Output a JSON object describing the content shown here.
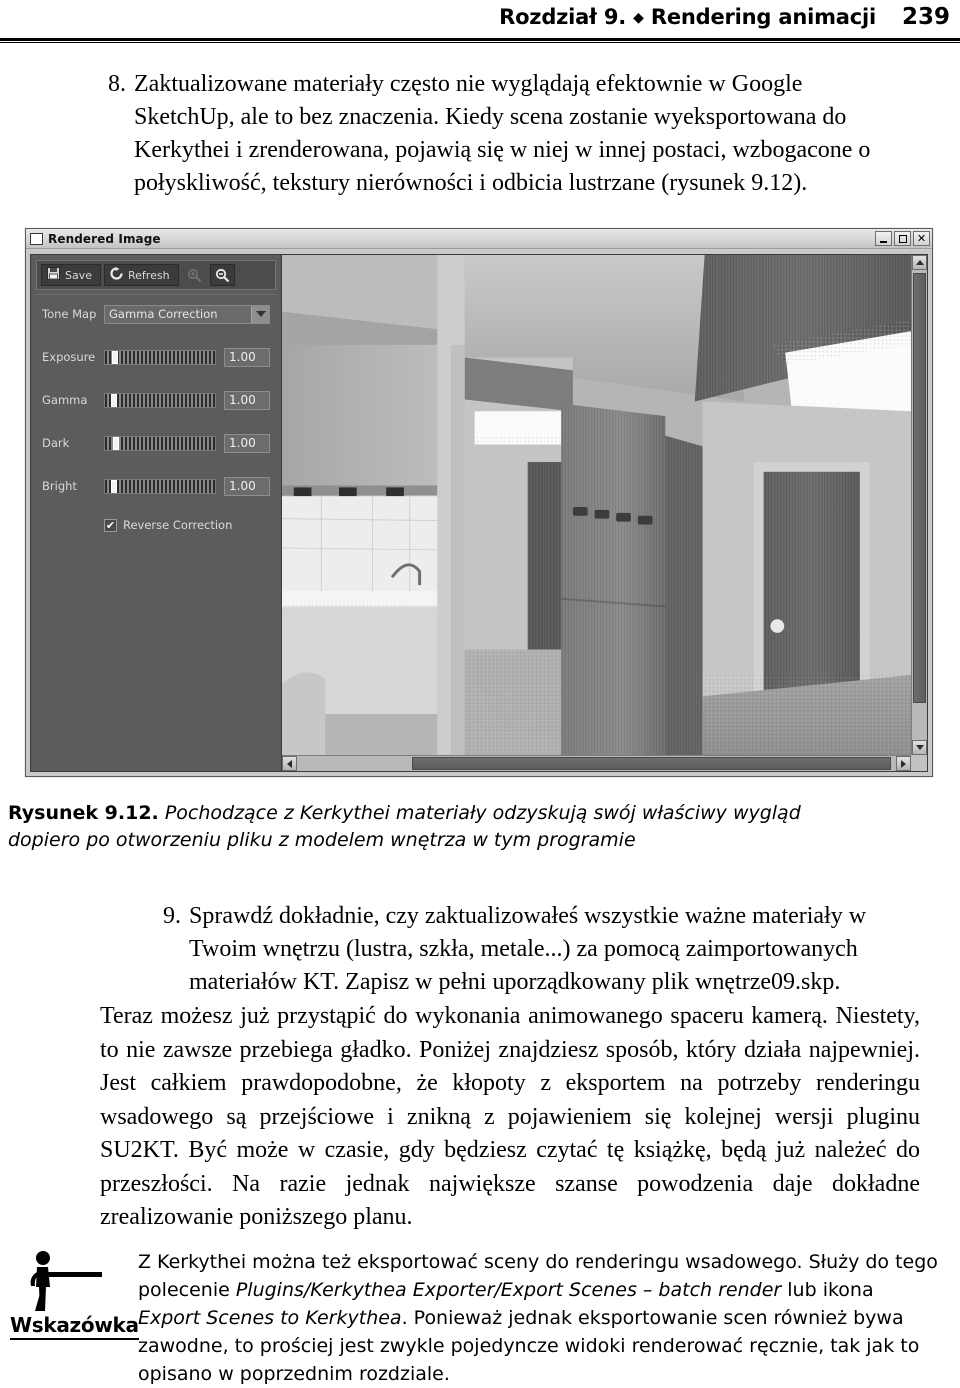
{
  "header": {
    "chapter": "Rozdział 9.",
    "diamond": "◆",
    "title": "Rendering animacji",
    "page_number": "239"
  },
  "steps": [
    {
      "number": "8.",
      "text": "Zaktualizowane materiały często nie wyglądają efektownie w Google SketchUp, ale to bez znaczenia. Kiedy scena zostanie wyeksportowana do Kerkythei i zrenderowana, pojawią się w niej w innej postaci, wzbogacone o połyskliwość, tekstury nierówności i odbicia lustrzane (rysunek 9.12)."
    },
    {
      "number": "9.",
      "text": "Sprawdź dokładnie, czy zaktualizowałeś wszystkie ważne materiały w Twoim wnętrzu (lustra, szkła, metale...) za pomocą zaimportowanych materiałów KT. Zapisz w pełni uporządkowany plik wnętrze09.skp."
    }
  ],
  "figure_caption": {
    "label": "Rysunek 9.12.",
    "text": "Pochodzące z Kerkythei materiały odzyskują swój właściwy wygląd dopiero po otworzeniu pliku z modelem wnętrza w tym programie"
  },
  "paragraph": "Teraz możesz już przystąpić do wykonania animowanego spaceru kamerą. Niestety, to nie zawsze przebiega gładko. Poniżej znajdziesz sposób, który działa najpewniej. Jest całkiem prawdopodobne, że kłopoty z eksportem na potrzeby renderingu wsadowego są przejściowe i znikną z pojawieniem się kolejnej wersji pluginu SU2KT. Być może w czasie, gdy będziesz czytać tę książkę, będą już należeć do przeszłości. Na razie jednak największe szanse powodzenia daje dokładne zrealizowanie poniższego planu.",
  "tip": {
    "label": "Wskazówka",
    "text_parts": [
      {
        "style": "normal",
        "text": "Z Kerkythei można też eksportować sceny do renderingu wsadowego. Służy do tego polecenie "
      },
      {
        "style": "italic",
        "text": "Plugins/Kerkythea Exporter/Export Scenes – batch render"
      },
      {
        "style": "normal",
        "text": " lub ikona "
      },
      {
        "style": "italic",
        "text": "Export Scenes to Kerkythea"
      },
      {
        "style": "normal",
        "text": ". Ponieważ jednak eksportowanie scen również bywa zawodne, to prościej jest zwykle pojedyncze widoki renderować ręcznie, tak jak to opisano w poprzednim rozdziale."
      }
    ]
  },
  "screenshot": {
    "window_title": "Rendered Image",
    "window_buttons": {
      "minimize": "_",
      "maximize": "□",
      "close": "×"
    },
    "toolbar": {
      "save_label": "Save",
      "refresh_label": "Refresh",
      "zoom_in_name": "zoom-in",
      "zoom_out_name": "zoom-out"
    },
    "controls": {
      "tone_map_label": "Tone Map",
      "tone_map_value": "Gamma Correction",
      "sliders": [
        {
          "label": "Exposure",
          "value": "1.00",
          "thumb_pct": 6
        },
        {
          "label": "Gamma",
          "value": "1.00",
          "thumb_pct": 5
        },
        {
          "label": "Dark",
          "value": "1.00",
          "thumb_pct": 7
        },
        {
          "label": "Bright",
          "value": "1.00",
          "thumb_pct": 5
        }
      ],
      "reverse_correction_label": "Reverse Correction",
      "reverse_correction_checked": "✔"
    }
  }
}
